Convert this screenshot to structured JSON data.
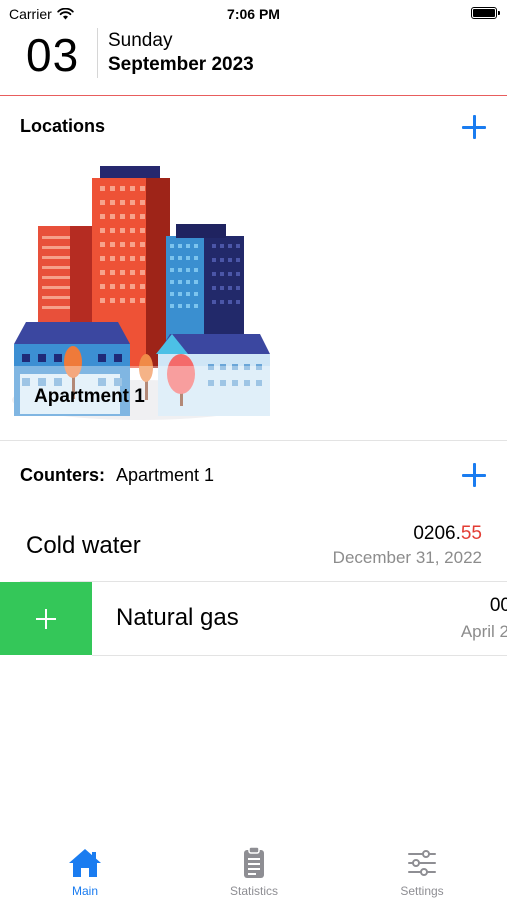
{
  "status_bar": {
    "carrier": "Carrier",
    "time": "7:06 PM"
  },
  "date_header": {
    "day": "03",
    "weekday": "Sunday",
    "month_year": "September 2023"
  },
  "locations": {
    "title": "Locations",
    "add_icon": "plus-icon",
    "items": [
      {
        "name": "Apartment 1"
      }
    ]
  },
  "counters": {
    "title": "Counters:",
    "location": "Apartment 1",
    "add_icon": "plus-icon",
    "items": [
      {
        "name": "Cold water",
        "value_int": "0206.",
        "value_frac": "55",
        "date": "December 31, 2022"
      },
      {
        "name": "Natural gas",
        "value_int": "00",
        "value_frac": "",
        "date": "April 2"
      }
    ],
    "swipe_action_icon": "plus-icon"
  },
  "tab_bar": {
    "tabs": [
      {
        "label": "Main",
        "icon": "home-icon",
        "active": true
      },
      {
        "label": "Statistics",
        "icon": "clipboard-icon",
        "active": false
      },
      {
        "label": "Settings",
        "icon": "sliders-icon",
        "active": false
      }
    ]
  },
  "colors": {
    "accent": "#1a7cf0",
    "header_line": "#e85d5d",
    "value_fraction": "#e33d34",
    "swipe_action": "#34c759",
    "inactive_tab": "#8e8e93"
  }
}
